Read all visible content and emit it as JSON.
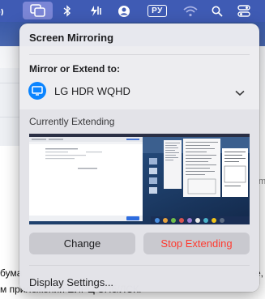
{
  "menubar": {
    "items": [
      {
        "name": "wifi-partial-icon"
      },
      {
        "name": "screen-mirroring-icon"
      },
      {
        "name": "bluetooth-icon"
      },
      {
        "name": "battery-charging-icon"
      },
      {
        "name": "user-icon"
      },
      {
        "name": "input-source-indicator",
        "label": "РУ"
      },
      {
        "name": "wifi-icon"
      },
      {
        "name": "spotlight-search-icon"
      },
      {
        "name": "control-center-icon"
      }
    ],
    "input_source": "РУ"
  },
  "popover": {
    "title": "Screen Mirroring",
    "mirror_label": "Mirror or Extend to:",
    "device": {
      "name": "LG HDR WQHD",
      "icon": "display-icon",
      "accent": "#0a84ff"
    },
    "extending_label": "Currently Extending",
    "buttons": {
      "change": "Change",
      "stop": "Stop Extending"
    },
    "display_settings": "Display Settings..."
  },
  "background": {
    "line1": "бума",
    "line1_right": "е,",
    "line2": "м приложении ЕИРЦ СПб/ЛСК.",
    "side_letter": "m"
  },
  "colors": {
    "menubar": "#3f5bb4",
    "stop_text": "#ff3b30",
    "accent": "#0a84ff"
  }
}
